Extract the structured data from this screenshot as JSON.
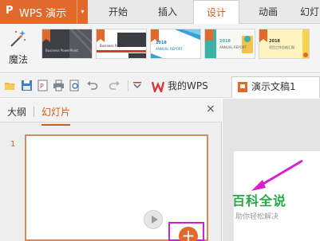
{
  "app": {
    "logo_glyph": "P",
    "title": "WPS 演示",
    "caret": "▾"
  },
  "menu_tabs": [
    {
      "label": "开始"
    },
    {
      "label": "插入"
    },
    {
      "label": "设计"
    },
    {
      "label": "动画"
    },
    {
      "label": "幻灯"
    }
  ],
  "active_menu_tab": "设计",
  "ribbon": {
    "magic_label": "魔法",
    "themes": [
      {
        "line1": "",
        "line2": "Business PowerPoint"
      },
      {
        "line1": "",
        "line2": "Business Report"
      },
      {
        "line1": "2018",
        "line2": "ANNUAL REPORT"
      },
      {
        "line1": "2018",
        "line2": "ANNUAL REPORT"
      },
      {
        "line1": "2018",
        "line2": "项目工作总结汇报"
      }
    ]
  },
  "toolbar": {
    "my_wps_label": "我的WPS",
    "doc_tab_label": "演示文稿1"
  },
  "slide_pane": {
    "tab_outline": "大纲",
    "tab_slides": "幻灯片",
    "close_glyph": "×",
    "slide_number": "1",
    "add_glyph": "+"
  },
  "watermark": {
    "title": "百科全说",
    "subtitle": "助你轻松解决"
  },
  "colors": {
    "accent": "#e0692b",
    "highlight": "#d61fd1",
    "watermark_green": "#27a54a"
  }
}
